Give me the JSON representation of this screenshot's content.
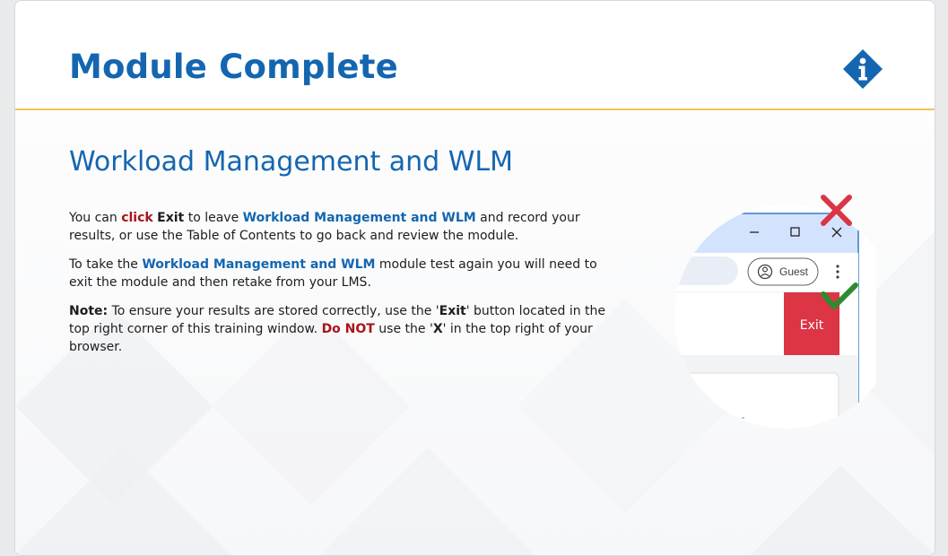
{
  "header": {
    "title": "Module Complete"
  },
  "body": {
    "subtitle": "Workload Management and WLM",
    "p1": {
      "t1": "You can ",
      "click": "click",
      "t2": " ",
      "exit": "Exit",
      "t3": " to leave ",
      "module": "Workload Management and WLM",
      "t4": " and record your results, or use the Table of Contents to go back and review the module."
    },
    "p2": {
      "t1": "To take the ",
      "module": "Workload Management and WLM",
      "t2": " module test again you will need to exit the module and then retake from your LMS."
    },
    "p3": {
      "note": "Note:",
      "t1": " To ensure your results are stored correctly, use the '",
      "exit": "Exit",
      "t2": "' button located in the top right corner of this training window. ",
      "donot": "Do NOT",
      "t3": " use the '",
      "x": "X",
      "t4": "' in the top right of your browser."
    }
  },
  "illustration": {
    "guest_label": "Guest",
    "exit_label": "Exit"
  },
  "colors": {
    "brand_blue": "#1466b0",
    "accent_gold": "#f1c35a",
    "emphasis_red": "#a8141a",
    "exit_red": "#dc3545",
    "check_green": "#2e8b2e"
  },
  "icons": [
    "info-icon",
    "person-icon",
    "more-vert-icon",
    "minimize-icon",
    "maximize-icon",
    "close-icon",
    "red-cross-icon",
    "green-check-icon"
  ]
}
